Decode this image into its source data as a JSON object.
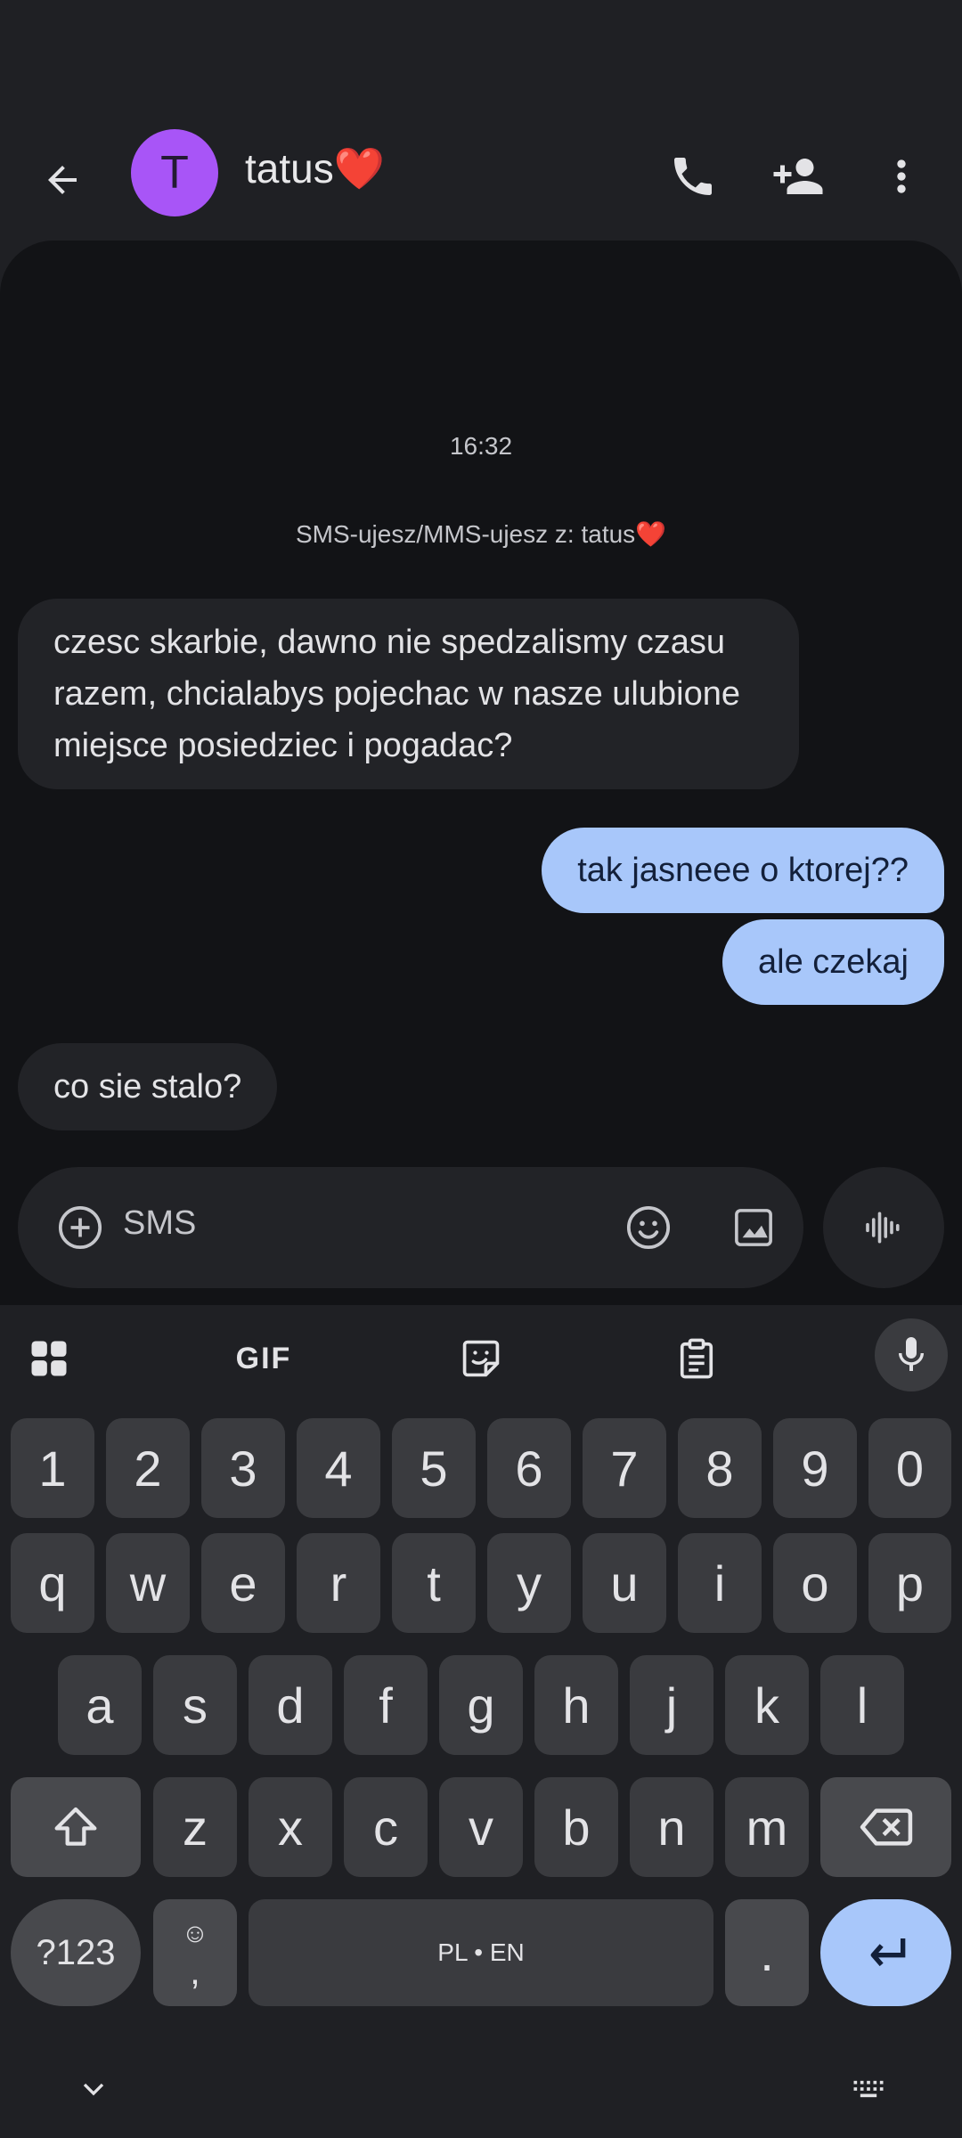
{
  "header": {
    "avatar_letter": "T",
    "contact_name": "tatus❤️"
  },
  "conversation": {
    "timestamp": "16:32",
    "info": "SMS-ujesz/MMS-ujesz z: tatus❤️",
    "messages": [
      {
        "direction": "incoming",
        "text": "czesc skarbie, dawno nie spedzalismy czasu razem, chcialabys pojechac w nasze ulubione miejsce posiedziec i pogadac?"
      },
      {
        "direction": "outgoing",
        "text": "tak jasneee o ktorej??"
      },
      {
        "direction": "outgoing",
        "text": "ale czekaj"
      },
      {
        "direction": "incoming",
        "text": "co sie stalo?"
      }
    ]
  },
  "compose": {
    "placeholder": "SMS"
  },
  "keyboard": {
    "gif_label": "GIF",
    "number_row": [
      "1",
      "2",
      "3",
      "4",
      "5",
      "6",
      "7",
      "8",
      "9",
      "0"
    ],
    "row1": [
      "q",
      "w",
      "e",
      "r",
      "t",
      "y",
      "u",
      "i",
      "o",
      "p"
    ],
    "row2": [
      "a",
      "s",
      "d",
      "f",
      "g",
      "h",
      "j",
      "k",
      "l"
    ],
    "row3": [
      "z",
      "x",
      "c",
      "v",
      "b",
      "n",
      "m"
    ],
    "symbols_label": "?123",
    "emoji_key_top": "☺",
    "emoji_key_bottom": ",",
    "space_label": "PL • EN",
    "period_label": "."
  },
  "colors": {
    "avatar": "#a855f7",
    "outgoing_bubble": "#a8c7fa",
    "incoming_bubble": "#222327",
    "background": "#121316"
  }
}
